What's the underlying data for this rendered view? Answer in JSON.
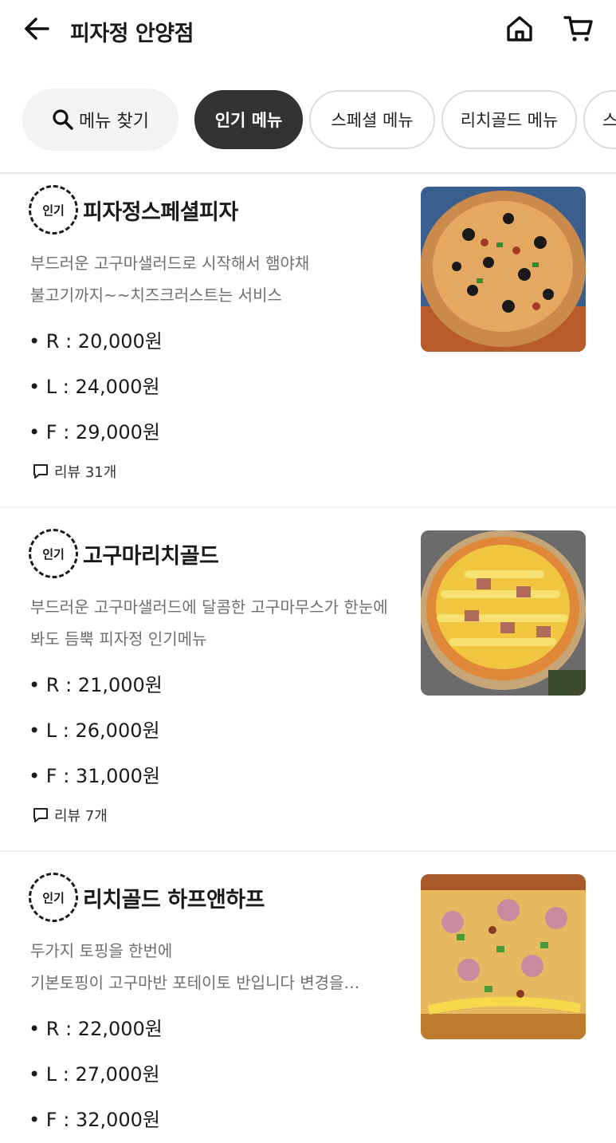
{
  "header": {
    "title": "피자정 안양점"
  },
  "categories": {
    "search_label": "메뉴 찾기",
    "chips": [
      "인기 메뉴",
      "스페셜 메뉴",
      "리치골드 메뉴",
      "스"
    ]
  },
  "badge_label": "인기",
  "items": [
    {
      "name": "피자정스페셜피자",
      "desc_line1": "부드러운 고구마샐러드로 시작해서 햄야채",
      "desc_line2": "불고기까지~~치즈크러스트는 서비스",
      "prices": [
        "• R : 20,000원",
        "• L : 24,000원",
        "• F : 29,000원"
      ],
      "review": "리뷰 31개"
    },
    {
      "name": "고구마리치골드",
      "desc_line1": "부드러운 고구마샐러드에 달콤한 고구마무스가 한눈에",
      "desc_line2": "봐도 듬뿍 피자정 인기메뉴",
      "prices": [
        "• R : 21,000원",
        "• L : 26,000원",
        "• F : 31,000원"
      ],
      "review": "리뷰 7개"
    },
    {
      "name": "리치골드 하프앤하프",
      "desc_line1": "두가지 토핑을 한번에",
      "desc_line2": "기본토핑이 고구마반 포테이토 반입니다 변경을…",
      "prices": [
        "• R : 22,000원",
        "• L : 27,000원",
        "• F : 32,000원"
      ]
    }
  ],
  "icons": {
    "back": "arrow-left-icon",
    "home": "home-icon",
    "cart": "cart-icon",
    "search": "search-icon",
    "review": "speech-bubble-icon"
  }
}
